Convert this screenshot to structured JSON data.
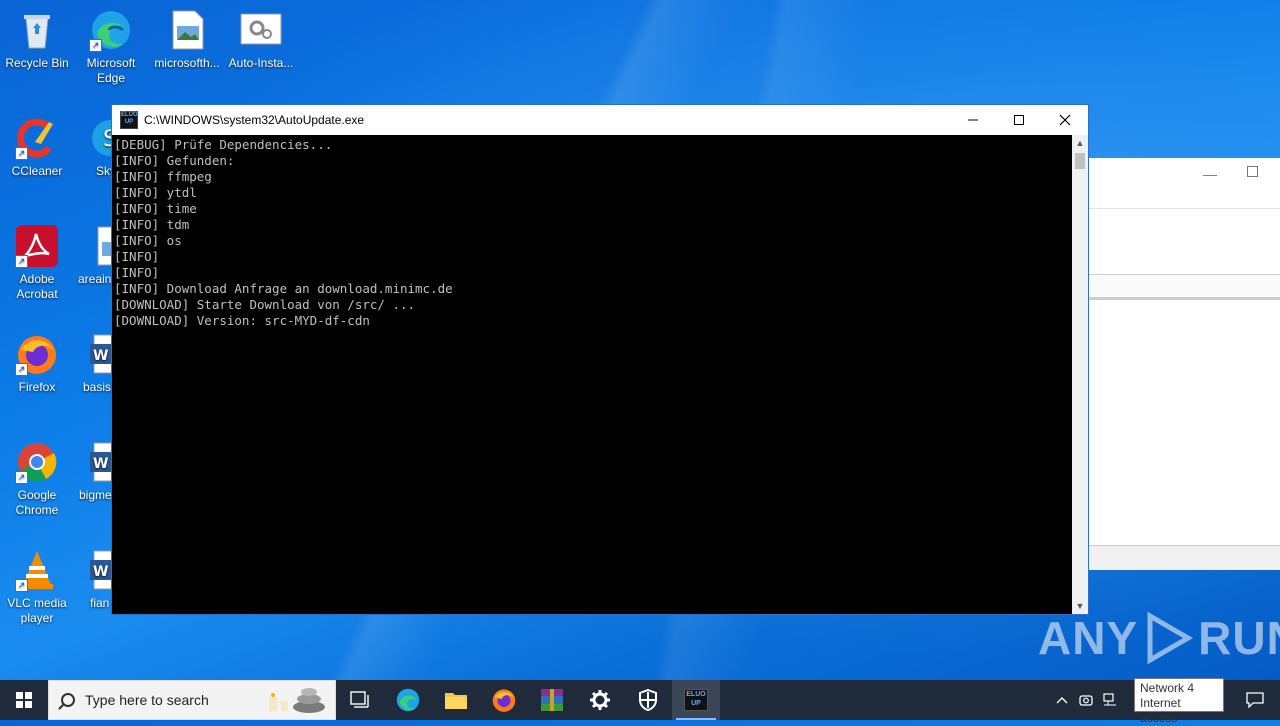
{
  "desktop": {
    "icons": [
      {
        "label": "Recycle Bin"
      },
      {
        "label": "Microsoft Edge"
      },
      {
        "label": "microsofth..."
      },
      {
        "label": "Auto-Insta..."
      },
      {
        "label": "CCleaner"
      },
      {
        "label": "Sky"
      },
      {
        "label": "Adobe Acrobat"
      },
      {
        "label": "areaine"
      },
      {
        "label": "Firefox"
      },
      {
        "label": "basis"
      },
      {
        "label": "Google Chrome"
      },
      {
        "label": "bigme"
      },
      {
        "label": "VLC media player"
      },
      {
        "label": "fian"
      }
    ]
  },
  "console": {
    "title": "C:\\WINDOWS\\system32\\AutoUpdate.exe",
    "app_icon_text": "ELUO UP",
    "lines": [
      "[DEBUG] Prüfe Dependencies...",
      "[INFO] Gefunden:",
      "[INFO] ffmpeg",
      "[INFO] ytdl",
      "[INFO] time",
      "[INFO] tdm",
      "[INFO] os",
      "[INFO]",
      "[INFO]",
      "[INFO] Download Anfrage an download.minimc.de",
      "[DOWNLOAD] Starte Download von /src/ ...",
      "[DOWNLOAD] Version: src-MYD-df-cdn"
    ]
  },
  "taskbar": {
    "search_placeholder": "Type here to search",
    "apps": [
      "task-view",
      "edge",
      "file-explorer",
      "firefox",
      "winrar",
      "settings",
      "security",
      "autoupdate"
    ]
  },
  "tray": {
    "tooltip_line1": "Network  4",
    "tooltip_line2": "Internet access"
  },
  "watermark": {
    "text_left": "ANY",
    "text_right": "RUN"
  },
  "colors": {
    "console_text": "#c0c0c0",
    "taskbar": "#1f2a3a",
    "desktop_accent": "#0b7be6"
  }
}
